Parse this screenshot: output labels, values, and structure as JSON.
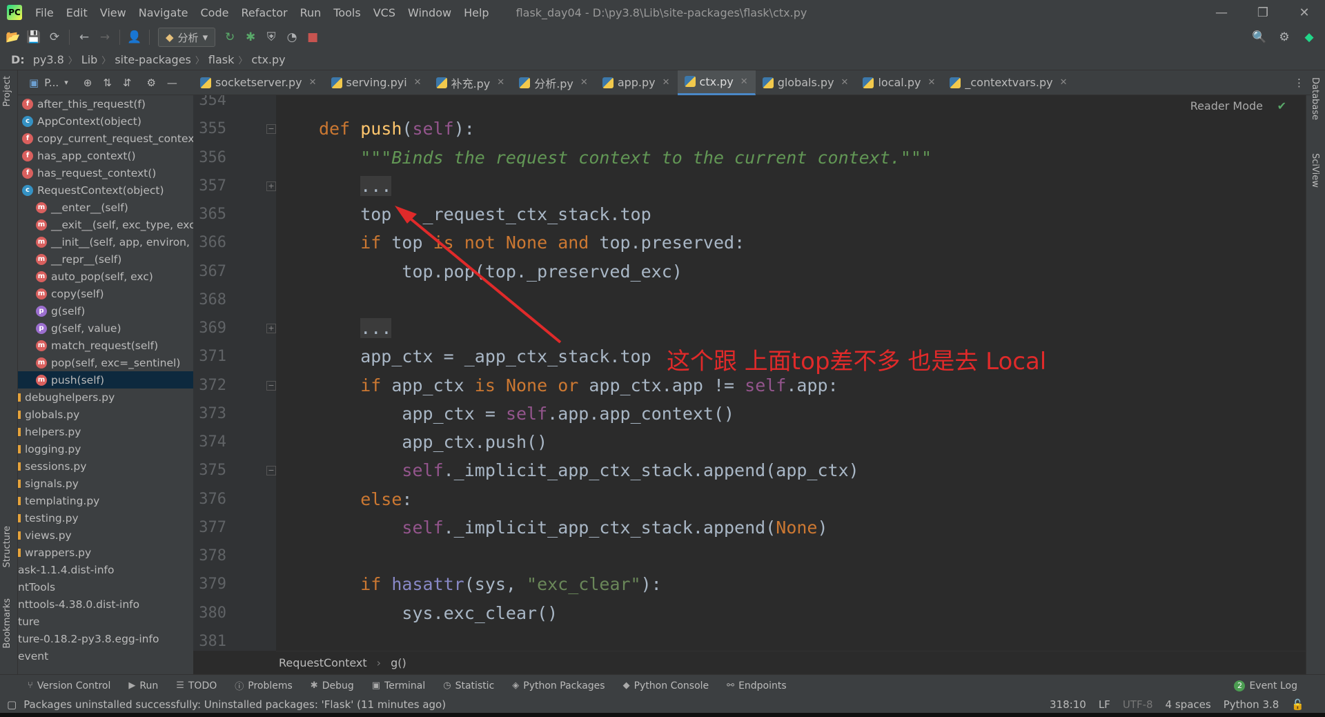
{
  "menubar": {
    "items": [
      "File",
      "Edit",
      "View",
      "Navigate",
      "Code",
      "Refactor",
      "Run",
      "Tools",
      "VCS",
      "Window",
      "Help"
    ],
    "title": "flask_day04 - D:\\py3.8\\Lib\\site-packages\\flask\\ctx.py"
  },
  "toolbar": {
    "run_config": "分析"
  },
  "breadcrumb": [
    "D:",
    "py3.8",
    "Lib",
    "site-packages",
    "flask",
    "ctx.py"
  ],
  "tabs": [
    "socketserver.py",
    "serving.pyi",
    "补充.py",
    "分析.py",
    "app.py",
    "ctx.py",
    "globals.py",
    "local.py",
    "_contextvars.py"
  ],
  "project_panel": {
    "header": "P...",
    "items": [
      {
        "badge": "f",
        "label": "after_this_request(f)"
      },
      {
        "badge": "c",
        "label": "AppContext(object)"
      },
      {
        "badge": "f",
        "label": "copy_current_request_context"
      },
      {
        "badge": "f",
        "label": "has_app_context()"
      },
      {
        "badge": "f",
        "label": "has_request_context()"
      },
      {
        "badge": "c",
        "label": "RequestContext(object)"
      },
      {
        "badge": "m",
        "label": "__enter__(self)"
      },
      {
        "badge": "m",
        "label": "__exit__(self, exc_type, exc_"
      },
      {
        "badge": "m",
        "label": "__init__(self, app, environ, re"
      },
      {
        "badge": "m",
        "label": "__repr__(self)"
      },
      {
        "badge": "m",
        "label": "auto_pop(self, exc)"
      },
      {
        "badge": "m",
        "label": "copy(self)"
      },
      {
        "badge": "p",
        "label": "g(self)"
      },
      {
        "badge": "p",
        "label": "g(self, value)"
      },
      {
        "badge": "m",
        "label": "match_request(self)"
      },
      {
        "badge": "m",
        "label": "pop(self, exc=_sentinel)"
      },
      {
        "badge": "m",
        "label": "push(self)"
      }
    ],
    "files": [
      "debughelpers.py",
      "globals.py",
      "helpers.py",
      "logging.py",
      "sessions.py",
      "signals.py",
      "templating.py",
      "testing.py",
      "views.py",
      "wrappers.py"
    ],
    "folders": [
      "ask-1.1.4.dist-info",
      "ntTools",
      "nttools-4.38.0.dist-info",
      "ture",
      "ture-0.18.2-py3.8.egg-info",
      "event"
    ]
  },
  "left_strip": {
    "project": "Project",
    "structure": "Structure",
    "bookmarks": "Bookmarks"
  },
  "right_strip": {
    "database": "Database",
    "sciview": "SciView"
  },
  "editor": {
    "reader_mode": "Reader Mode",
    "line_numbers": [
      "354",
      "355",
      "356",
      "357",
      "365",
      "366",
      "367",
      "368",
      "369",
      "371",
      "372",
      "373",
      "374",
      "375",
      "376",
      "377",
      "378",
      "379",
      "380",
      "381"
    ],
    "breadcrumb": [
      "RequestContext",
      "g()"
    ]
  },
  "annotation": "这个跟 上面top差不多 也是去 Local",
  "bottom_tools": [
    "Version Control",
    "Run",
    "TODO",
    "Problems",
    "Debug",
    "Terminal",
    "Statistic",
    "Python Packages",
    "Python Console",
    "Endpoints"
  ],
  "event_log": {
    "count": "2",
    "label": "Event Log"
  },
  "status": {
    "message": "Packages uninstalled successfully: Uninstalled packages: 'Flask' (11 minutes ago)",
    "position": "318:10",
    "line_sep": "LF",
    "encoding": "UTF-8",
    "indent": "4 spaces",
    "interpreter": "Python 3.8"
  }
}
